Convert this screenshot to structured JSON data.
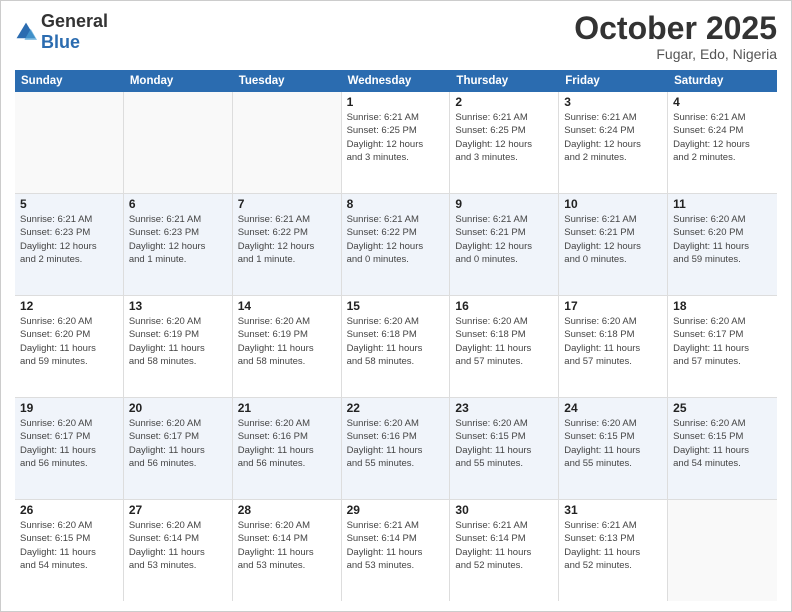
{
  "header": {
    "logo": {
      "general": "General",
      "blue": "Blue"
    },
    "month_title": "October 2025",
    "subtitle": "Fugar, Edo, Nigeria"
  },
  "weekdays": [
    "Sunday",
    "Monday",
    "Tuesday",
    "Wednesday",
    "Thursday",
    "Friday",
    "Saturday"
  ],
  "rows": [
    {
      "cells": [
        {
          "day": "",
          "info": "",
          "empty": true
        },
        {
          "day": "",
          "info": "",
          "empty": true
        },
        {
          "day": "",
          "info": "",
          "empty": true
        },
        {
          "day": "1",
          "info": "Sunrise: 6:21 AM\nSunset: 6:25 PM\nDaylight: 12 hours\nand 3 minutes.",
          "empty": false
        },
        {
          "day": "2",
          "info": "Sunrise: 6:21 AM\nSunset: 6:25 PM\nDaylight: 12 hours\nand 3 minutes.",
          "empty": false
        },
        {
          "day": "3",
          "info": "Sunrise: 6:21 AM\nSunset: 6:24 PM\nDaylight: 12 hours\nand 2 minutes.",
          "empty": false
        },
        {
          "day": "4",
          "info": "Sunrise: 6:21 AM\nSunset: 6:24 PM\nDaylight: 12 hours\nand 2 minutes.",
          "empty": false
        }
      ]
    },
    {
      "cells": [
        {
          "day": "5",
          "info": "Sunrise: 6:21 AM\nSunset: 6:23 PM\nDaylight: 12 hours\nand 2 minutes.",
          "empty": false
        },
        {
          "day": "6",
          "info": "Sunrise: 6:21 AM\nSunset: 6:23 PM\nDaylight: 12 hours\nand 1 minute.",
          "empty": false
        },
        {
          "day": "7",
          "info": "Sunrise: 6:21 AM\nSunset: 6:22 PM\nDaylight: 12 hours\nand 1 minute.",
          "empty": false
        },
        {
          "day": "8",
          "info": "Sunrise: 6:21 AM\nSunset: 6:22 PM\nDaylight: 12 hours\nand 0 minutes.",
          "empty": false
        },
        {
          "day": "9",
          "info": "Sunrise: 6:21 AM\nSunset: 6:21 PM\nDaylight: 12 hours\nand 0 minutes.",
          "empty": false
        },
        {
          "day": "10",
          "info": "Sunrise: 6:21 AM\nSunset: 6:21 PM\nDaylight: 12 hours\nand 0 minutes.",
          "empty": false
        },
        {
          "day": "11",
          "info": "Sunrise: 6:20 AM\nSunset: 6:20 PM\nDaylight: 11 hours\nand 59 minutes.",
          "empty": false
        }
      ]
    },
    {
      "cells": [
        {
          "day": "12",
          "info": "Sunrise: 6:20 AM\nSunset: 6:20 PM\nDaylight: 11 hours\nand 59 minutes.",
          "empty": false
        },
        {
          "day": "13",
          "info": "Sunrise: 6:20 AM\nSunset: 6:19 PM\nDaylight: 11 hours\nand 58 minutes.",
          "empty": false
        },
        {
          "day": "14",
          "info": "Sunrise: 6:20 AM\nSunset: 6:19 PM\nDaylight: 11 hours\nand 58 minutes.",
          "empty": false
        },
        {
          "day": "15",
          "info": "Sunrise: 6:20 AM\nSunset: 6:18 PM\nDaylight: 11 hours\nand 58 minutes.",
          "empty": false
        },
        {
          "day": "16",
          "info": "Sunrise: 6:20 AM\nSunset: 6:18 PM\nDaylight: 11 hours\nand 57 minutes.",
          "empty": false
        },
        {
          "day": "17",
          "info": "Sunrise: 6:20 AM\nSunset: 6:18 PM\nDaylight: 11 hours\nand 57 minutes.",
          "empty": false
        },
        {
          "day": "18",
          "info": "Sunrise: 6:20 AM\nSunset: 6:17 PM\nDaylight: 11 hours\nand 57 minutes.",
          "empty": false
        }
      ]
    },
    {
      "cells": [
        {
          "day": "19",
          "info": "Sunrise: 6:20 AM\nSunset: 6:17 PM\nDaylight: 11 hours\nand 56 minutes.",
          "empty": false
        },
        {
          "day": "20",
          "info": "Sunrise: 6:20 AM\nSunset: 6:17 PM\nDaylight: 11 hours\nand 56 minutes.",
          "empty": false
        },
        {
          "day": "21",
          "info": "Sunrise: 6:20 AM\nSunset: 6:16 PM\nDaylight: 11 hours\nand 56 minutes.",
          "empty": false
        },
        {
          "day": "22",
          "info": "Sunrise: 6:20 AM\nSunset: 6:16 PM\nDaylight: 11 hours\nand 55 minutes.",
          "empty": false
        },
        {
          "day": "23",
          "info": "Sunrise: 6:20 AM\nSunset: 6:15 PM\nDaylight: 11 hours\nand 55 minutes.",
          "empty": false
        },
        {
          "day": "24",
          "info": "Sunrise: 6:20 AM\nSunset: 6:15 PM\nDaylight: 11 hours\nand 55 minutes.",
          "empty": false
        },
        {
          "day": "25",
          "info": "Sunrise: 6:20 AM\nSunset: 6:15 PM\nDaylight: 11 hours\nand 54 minutes.",
          "empty": false
        }
      ]
    },
    {
      "cells": [
        {
          "day": "26",
          "info": "Sunrise: 6:20 AM\nSunset: 6:15 PM\nDaylight: 11 hours\nand 54 minutes.",
          "empty": false
        },
        {
          "day": "27",
          "info": "Sunrise: 6:20 AM\nSunset: 6:14 PM\nDaylight: 11 hours\nand 53 minutes.",
          "empty": false
        },
        {
          "day": "28",
          "info": "Sunrise: 6:20 AM\nSunset: 6:14 PM\nDaylight: 11 hours\nand 53 minutes.",
          "empty": false
        },
        {
          "day": "29",
          "info": "Sunrise: 6:21 AM\nSunset: 6:14 PM\nDaylight: 11 hours\nand 53 minutes.",
          "empty": false
        },
        {
          "day": "30",
          "info": "Sunrise: 6:21 AM\nSunset: 6:14 PM\nDaylight: 11 hours\nand 52 minutes.",
          "empty": false
        },
        {
          "day": "31",
          "info": "Sunrise: 6:21 AM\nSunset: 6:13 PM\nDaylight: 11 hours\nand 52 minutes.",
          "empty": false
        },
        {
          "day": "",
          "info": "",
          "empty": true
        }
      ]
    }
  ]
}
